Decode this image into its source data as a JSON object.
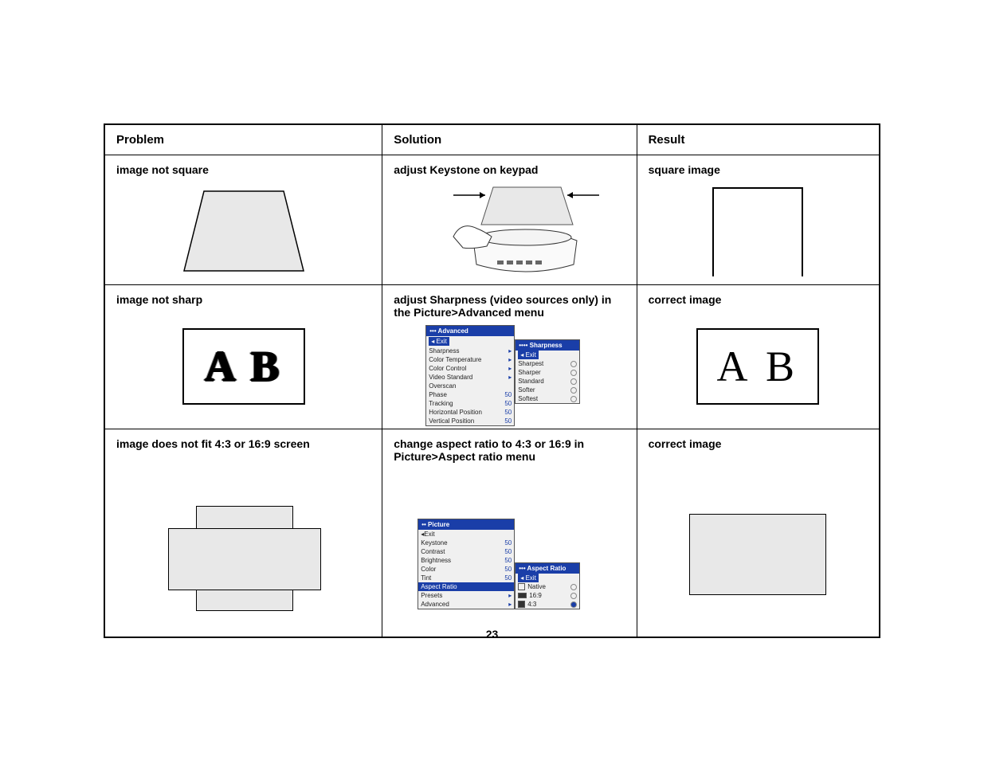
{
  "page_number": "23",
  "headers": {
    "problem": "Problem",
    "solution": "Solution",
    "result": "Result"
  },
  "rows": [
    {
      "problem_title": "image not square",
      "solution_title": "adjust Keystone on keypad",
      "result_title": "square image"
    },
    {
      "problem_title": "image not sharp",
      "solution_title": "adjust Sharpness (video sources only) in the Picture>Advanced menu",
      "result_title": "correct image",
      "problem_graphic": "A B",
      "result_graphic": "A B",
      "menu1": {
        "title": "••• Advanced",
        "exit": "Exit",
        "items": [
          {
            "label": "Sharpness",
            "val": "▸"
          },
          {
            "label": "Color Temperature",
            "val": "▸"
          },
          {
            "label": "Color Control",
            "val": "▸"
          },
          {
            "label": "Video Standard",
            "val": "▸"
          },
          {
            "label": "Overscan",
            "val": ""
          },
          {
            "label": "Phase",
            "val": "50"
          },
          {
            "label": "Tracking",
            "val": "50"
          },
          {
            "label": "Horizontal Position",
            "val": "50"
          },
          {
            "label": "Vertical Position",
            "val": "50"
          }
        ]
      },
      "submenu1": {
        "title": "•••• Sharpness",
        "exit": "Exit",
        "items": [
          "Sharpest",
          "Sharper",
          "Standard",
          "Softer",
          "Softest"
        ]
      }
    },
    {
      "problem_title": "image does not fit 4:3 or 16:9 screen",
      "solution_title": "change aspect ratio to 4:3 or 16:9 in Picture>Aspect ratio menu",
      "result_title": "correct image",
      "menu2": {
        "title": "•• Picture",
        "exit": "Exit",
        "items": [
          {
            "label": "Keystone",
            "val": "50"
          },
          {
            "label": "Contrast",
            "val": "50"
          },
          {
            "label": "Brightness",
            "val": "50"
          },
          {
            "label": "Color",
            "val": "50"
          },
          {
            "label": "Tint",
            "val": "50"
          },
          {
            "label": "Aspect Ratio",
            "val": "",
            "sel": true
          },
          {
            "label": "Presets",
            "val": "▸"
          },
          {
            "label": "Advanced",
            "val": "▸"
          }
        ]
      },
      "submenu2": {
        "title": "••• Aspect Ratio",
        "exit": "Exit",
        "items": [
          "Native",
          "16:9",
          "4:3"
        ]
      }
    }
  ]
}
